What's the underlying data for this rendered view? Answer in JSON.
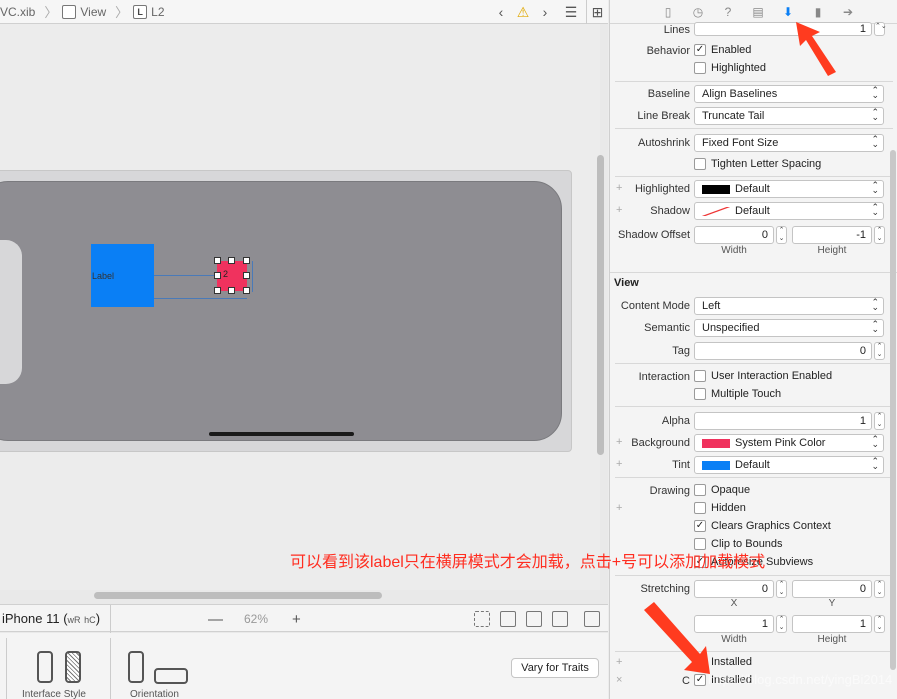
{
  "jumpbar": {
    "file": "VC.xib",
    "view": "View",
    "label_item": "L2",
    "label_badge": "L"
  },
  "canvas": {
    "label1_text": "Label",
    "label2_text": "2"
  },
  "device_bar": {
    "device": "iPhone 11",
    "size_class_w": "wR",
    "size_class_h": "hC",
    "zoom": "62%",
    "zoom_out": "—",
    "zoom_in": "+"
  },
  "traits": {
    "interface_style": "Interface Style",
    "orientation": "Orientation",
    "vary_button": "Vary for Traits"
  },
  "inspector": {
    "lines": {
      "label": "Lines",
      "value": "1"
    },
    "behavior": {
      "label": "Behavior",
      "enabled": "Enabled",
      "highlighted": "Highlighted"
    },
    "baseline": {
      "label": "Baseline",
      "value": "Align Baselines"
    },
    "line_break": {
      "label": "Line Break",
      "value": "Truncate Tail"
    },
    "autoshrink": {
      "label": "Autoshrink",
      "value": "Fixed Font Size",
      "tighten": "Tighten Letter Spacing"
    },
    "highlighted_color": {
      "label": "Highlighted",
      "value": "Default"
    },
    "shadow": {
      "label": "Shadow",
      "value": "Default"
    },
    "shadow_offset": {
      "label": "Shadow Offset",
      "width": "0",
      "height": "-1",
      "width_lbl": "Width",
      "height_lbl": "Height"
    },
    "view_header": "View",
    "content_mode": {
      "label": "Content Mode",
      "value": "Left"
    },
    "semantic": {
      "label": "Semantic",
      "value": "Unspecified"
    },
    "tag": {
      "label": "Tag",
      "value": "0"
    },
    "interaction": {
      "label": "Interaction",
      "user": "User Interaction Enabled",
      "multi": "Multiple Touch"
    },
    "alpha": {
      "label": "Alpha",
      "value": "1"
    },
    "background": {
      "label": "Background",
      "value": "System Pink Color",
      "color": "#f0325e"
    },
    "tint": {
      "label": "Tint",
      "value": "Default",
      "color": "#0a7ff5"
    },
    "drawing": {
      "label": "Drawing",
      "opaque": "Opaque",
      "hidden": "Hidden",
      "clears": "Clears Graphics Context",
      "clip": "Clip to Bounds",
      "autoresize": "Autoresize Subviews"
    },
    "stretching": {
      "label": "Stretching",
      "x": "0",
      "y": "0",
      "w": "1",
      "h": "1",
      "x_lbl": "X",
      "y_lbl": "Y",
      "w_lbl": "Width",
      "h_lbl": "Height"
    },
    "installed1": "Installed",
    "installed2": "Installed",
    "installed2_prefix": "C"
  },
  "annotation": "可以看到该label只在横屏模式才会加载，点击+号可以添加加载模式",
  "watermark": "https://blog.csdn.net/yingBi2014",
  "colors": {
    "accent": "#0a7ff5",
    "pink": "#f0325e",
    "annotation": "#ff2d20"
  }
}
